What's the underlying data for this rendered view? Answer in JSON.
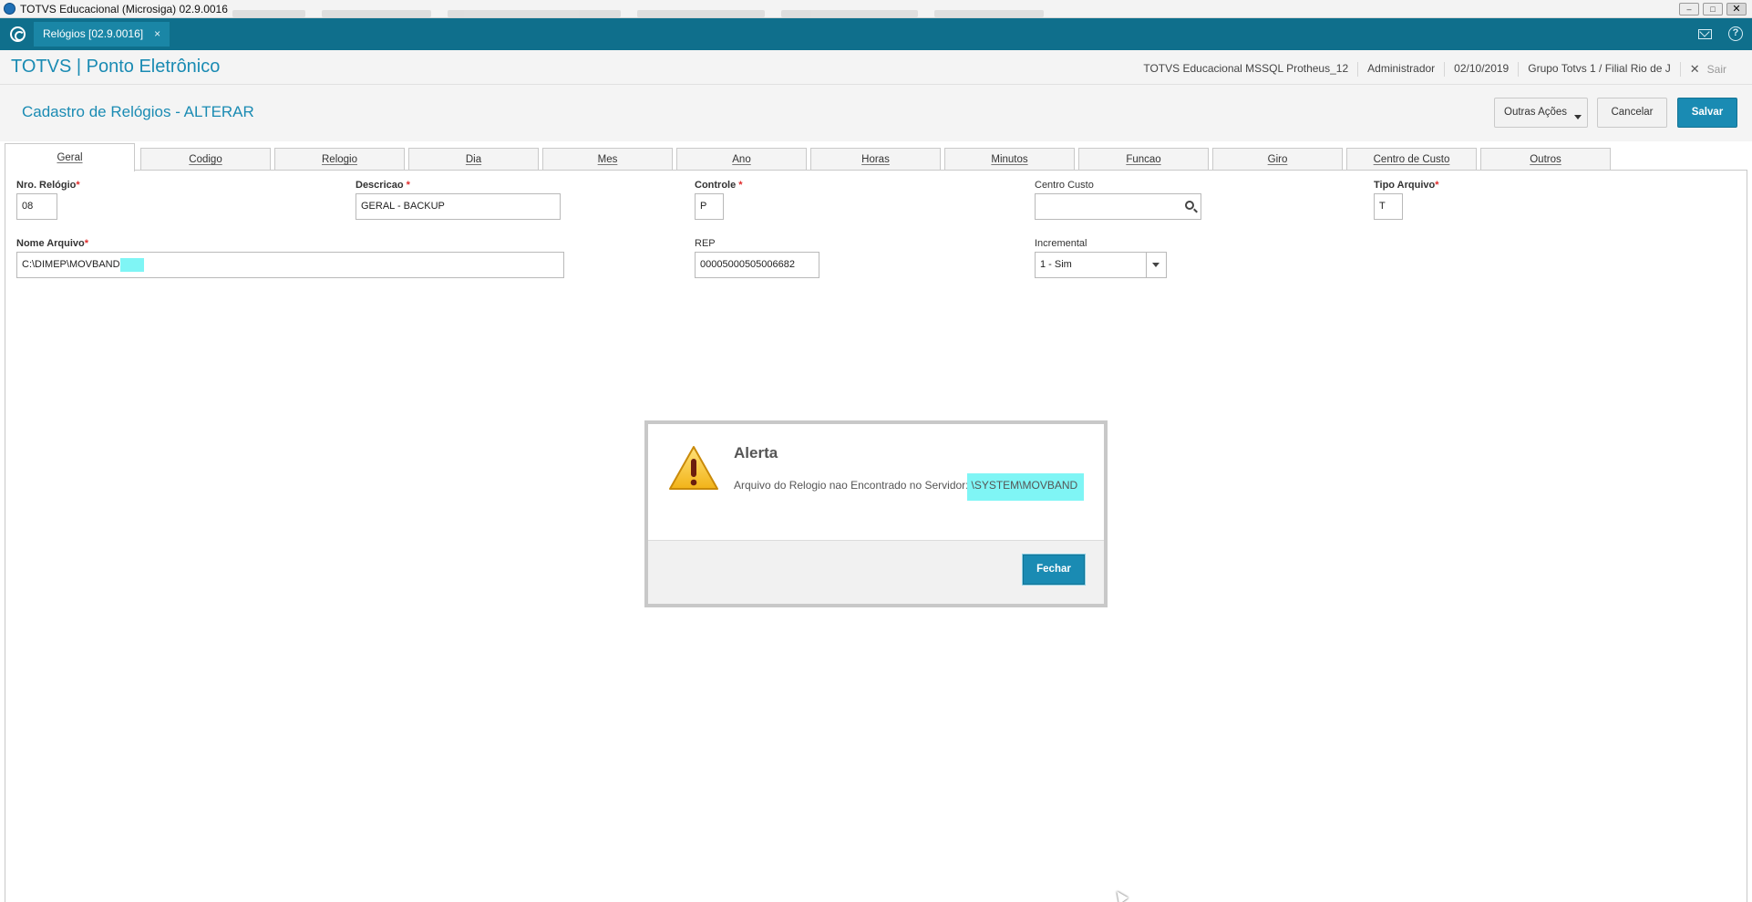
{
  "window": {
    "title": "TOTVS Educacional (Microsiga) 02.9.0016",
    "controls": {
      "minimize": "–",
      "maximize": "□",
      "close": "✕"
    }
  },
  "tabbar": {
    "module_tab": "Relógios [02.9.0016]",
    "module_tab_close": "×",
    "icons": [
      "home-icon",
      "mail-icon",
      "help-icon"
    ]
  },
  "header": {
    "brand": "TOTVS | Ponto Eletrônico",
    "environment": "TOTVS Educacional MSSQL Protheus_12",
    "user": "Administrador",
    "date": "02/10/2019",
    "branch": "Grupo Totvs 1 / Filial Rio de J",
    "exit_icon": "✕",
    "exit_label": "Sair",
    "help_glyph": "?"
  },
  "page": {
    "title": "Cadastro de Relógios - ALTERAR",
    "buttons": {
      "more": "Outras Ações",
      "cancel": "Cancelar",
      "save": "Salvar"
    }
  },
  "tabs": [
    {
      "label": "Geral",
      "active": true
    },
    {
      "label": "Codigo"
    },
    {
      "label": "Relogio"
    },
    {
      "label": "Dia"
    },
    {
      "label": "Mes"
    },
    {
      "label": "Ano"
    },
    {
      "label": "Horas"
    },
    {
      "label": "Minutos"
    },
    {
      "label": "Funcao"
    },
    {
      "label": "Giro"
    },
    {
      "label": "Centro de Custo"
    },
    {
      "label": "Outros"
    }
  ],
  "form": {
    "nro_relogio": {
      "label": "Nro. Relógio",
      "value": "08"
    },
    "descricao": {
      "label": "Descricao ",
      "value": "GERAL - BACKUP"
    },
    "controle": {
      "label": "Controle ",
      "value": "P"
    },
    "centro_custo": {
      "label": "Centro Custo",
      "value": ""
    },
    "tipo_arquivo": {
      "label": "Tipo Arquivo",
      "value": "T"
    },
    "nome_arquivo": {
      "label": "Nome Arquivo",
      "value": "C:\\DIMEP\\MOVBAND"
    },
    "rep": {
      "label": "REP",
      "value": "00005000505006682"
    },
    "incremental": {
      "label": "Incremental",
      "value": "1 - Sim"
    },
    "required_mark": "*"
  },
  "modal": {
    "title": "Alerta",
    "message": "Arquivo do Relogio nao Encontrado no Servidor:",
    "path": "\\SYSTEM\\MOVBAND",
    "close_button": "Fechar",
    "icon": "warning-icon"
  },
  "colors": {
    "teal_bar": "#0f6f8c",
    "accent": "#1a8bb3",
    "highlight": "#7ff5f5",
    "required": "#e02b2b"
  }
}
